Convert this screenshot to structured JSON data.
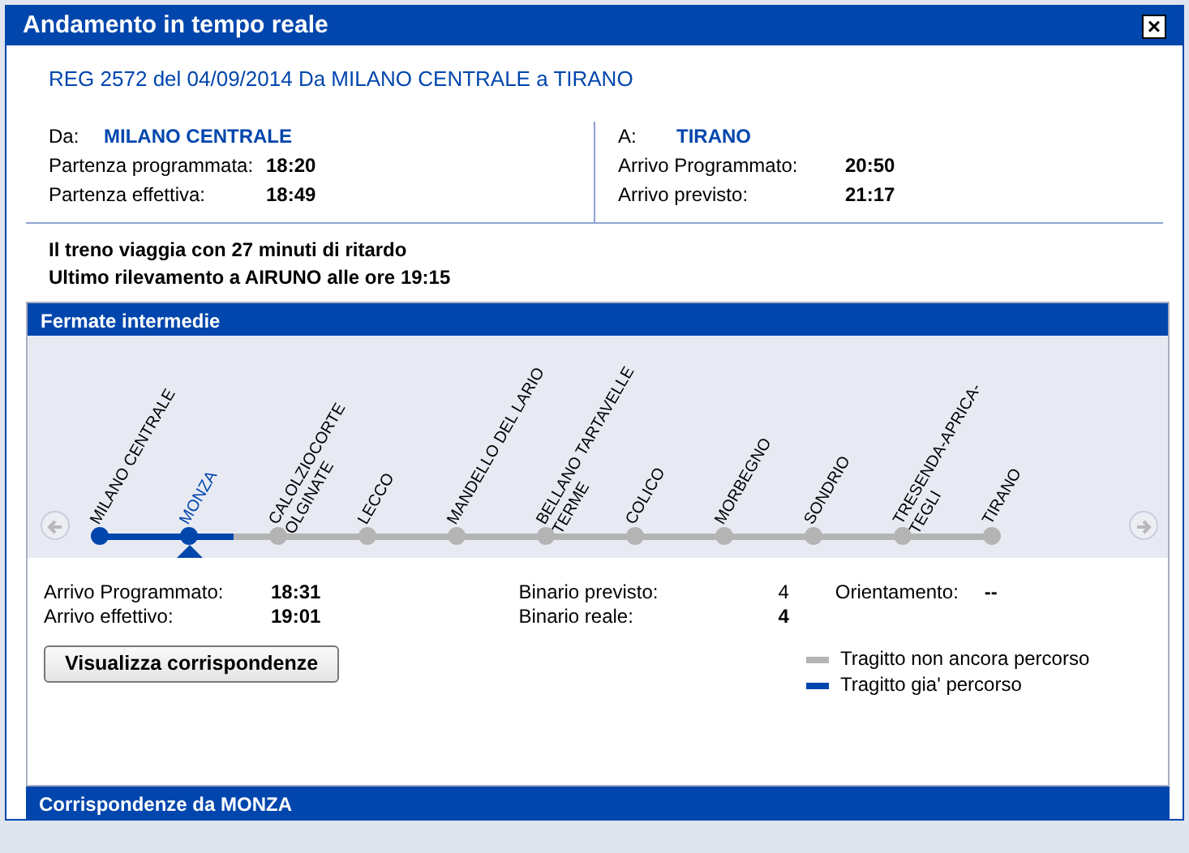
{
  "dialog": {
    "title": "Andamento in tempo reale",
    "close": "×"
  },
  "train": {
    "heading": "REG 2572 del 04/09/2014 Da MILANO CENTRALE a TIRANO",
    "origin": {
      "label": "Da:",
      "station": "MILANO CENTRALE",
      "rows": [
        {
          "label": "Partenza programmata:",
          "value": "18:20"
        },
        {
          "label": "Partenza effettiva:",
          "value": "18:49"
        }
      ]
    },
    "destination": {
      "label": "A:",
      "station": "TIRANO",
      "rows": [
        {
          "label": "Arrivo Programmato:",
          "value": "20:50"
        },
        {
          "label": "Arrivo previsto:",
          "value": "21:17"
        }
      ]
    },
    "status": [
      "Il treno viaggia con 27 minuti di ritardo",
      "Ultimo rilevamento a AIRUNO alle ore 19:15"
    ]
  },
  "stops_panel": {
    "title": "Fermate intermedie",
    "stops": [
      {
        "name": "MILANO CENTRALE",
        "passed": true,
        "selected": false
      },
      {
        "name": "MONZA",
        "passed": true,
        "selected": true
      },
      {
        "name": "CALOLZIOCORTE\nOLGINATE",
        "passed": false,
        "selected": false
      },
      {
        "name": "LECCO",
        "passed": false,
        "selected": false
      },
      {
        "name": "MANDELLO DEL LARIO",
        "passed": false,
        "selected": false
      },
      {
        "name": "BELLANO TARTAVELLE\nTERME",
        "passed": false,
        "selected": false
      },
      {
        "name": "COLICO",
        "passed": false,
        "selected": false
      },
      {
        "name": "MORBEGNO",
        "passed": false,
        "selected": false
      },
      {
        "name": "SONDRIO",
        "passed": false,
        "selected": false
      },
      {
        "name": "TRESENDA-APRICA-\nTEGLI",
        "passed": false,
        "selected": false
      },
      {
        "name": "TIRANO",
        "passed": false,
        "selected": false
      }
    ],
    "details": [
      [
        {
          "label": "Arrivo Programmato:",
          "value": "18:31"
        },
        {
          "label": "Arrivo effettivo:",
          "value": "19:01"
        }
      ],
      [
        {
          "label": "Binario previsto:",
          "value": "4",
          "bold": false
        },
        {
          "label": "Binario reale:",
          "value": "4",
          "bold": true
        }
      ],
      [
        {
          "label": "Orientamento:",
          "value": "--"
        }
      ]
    ],
    "button": "Visualizza corrispondenze",
    "legend": [
      {
        "kind": "pending",
        "label": "Tragitto non ancora percorso"
      },
      {
        "kind": "passed",
        "label": "Tragitto gia' percorso"
      }
    ]
  },
  "connections_panel": {
    "title": "Corrispondenze da MONZA"
  }
}
